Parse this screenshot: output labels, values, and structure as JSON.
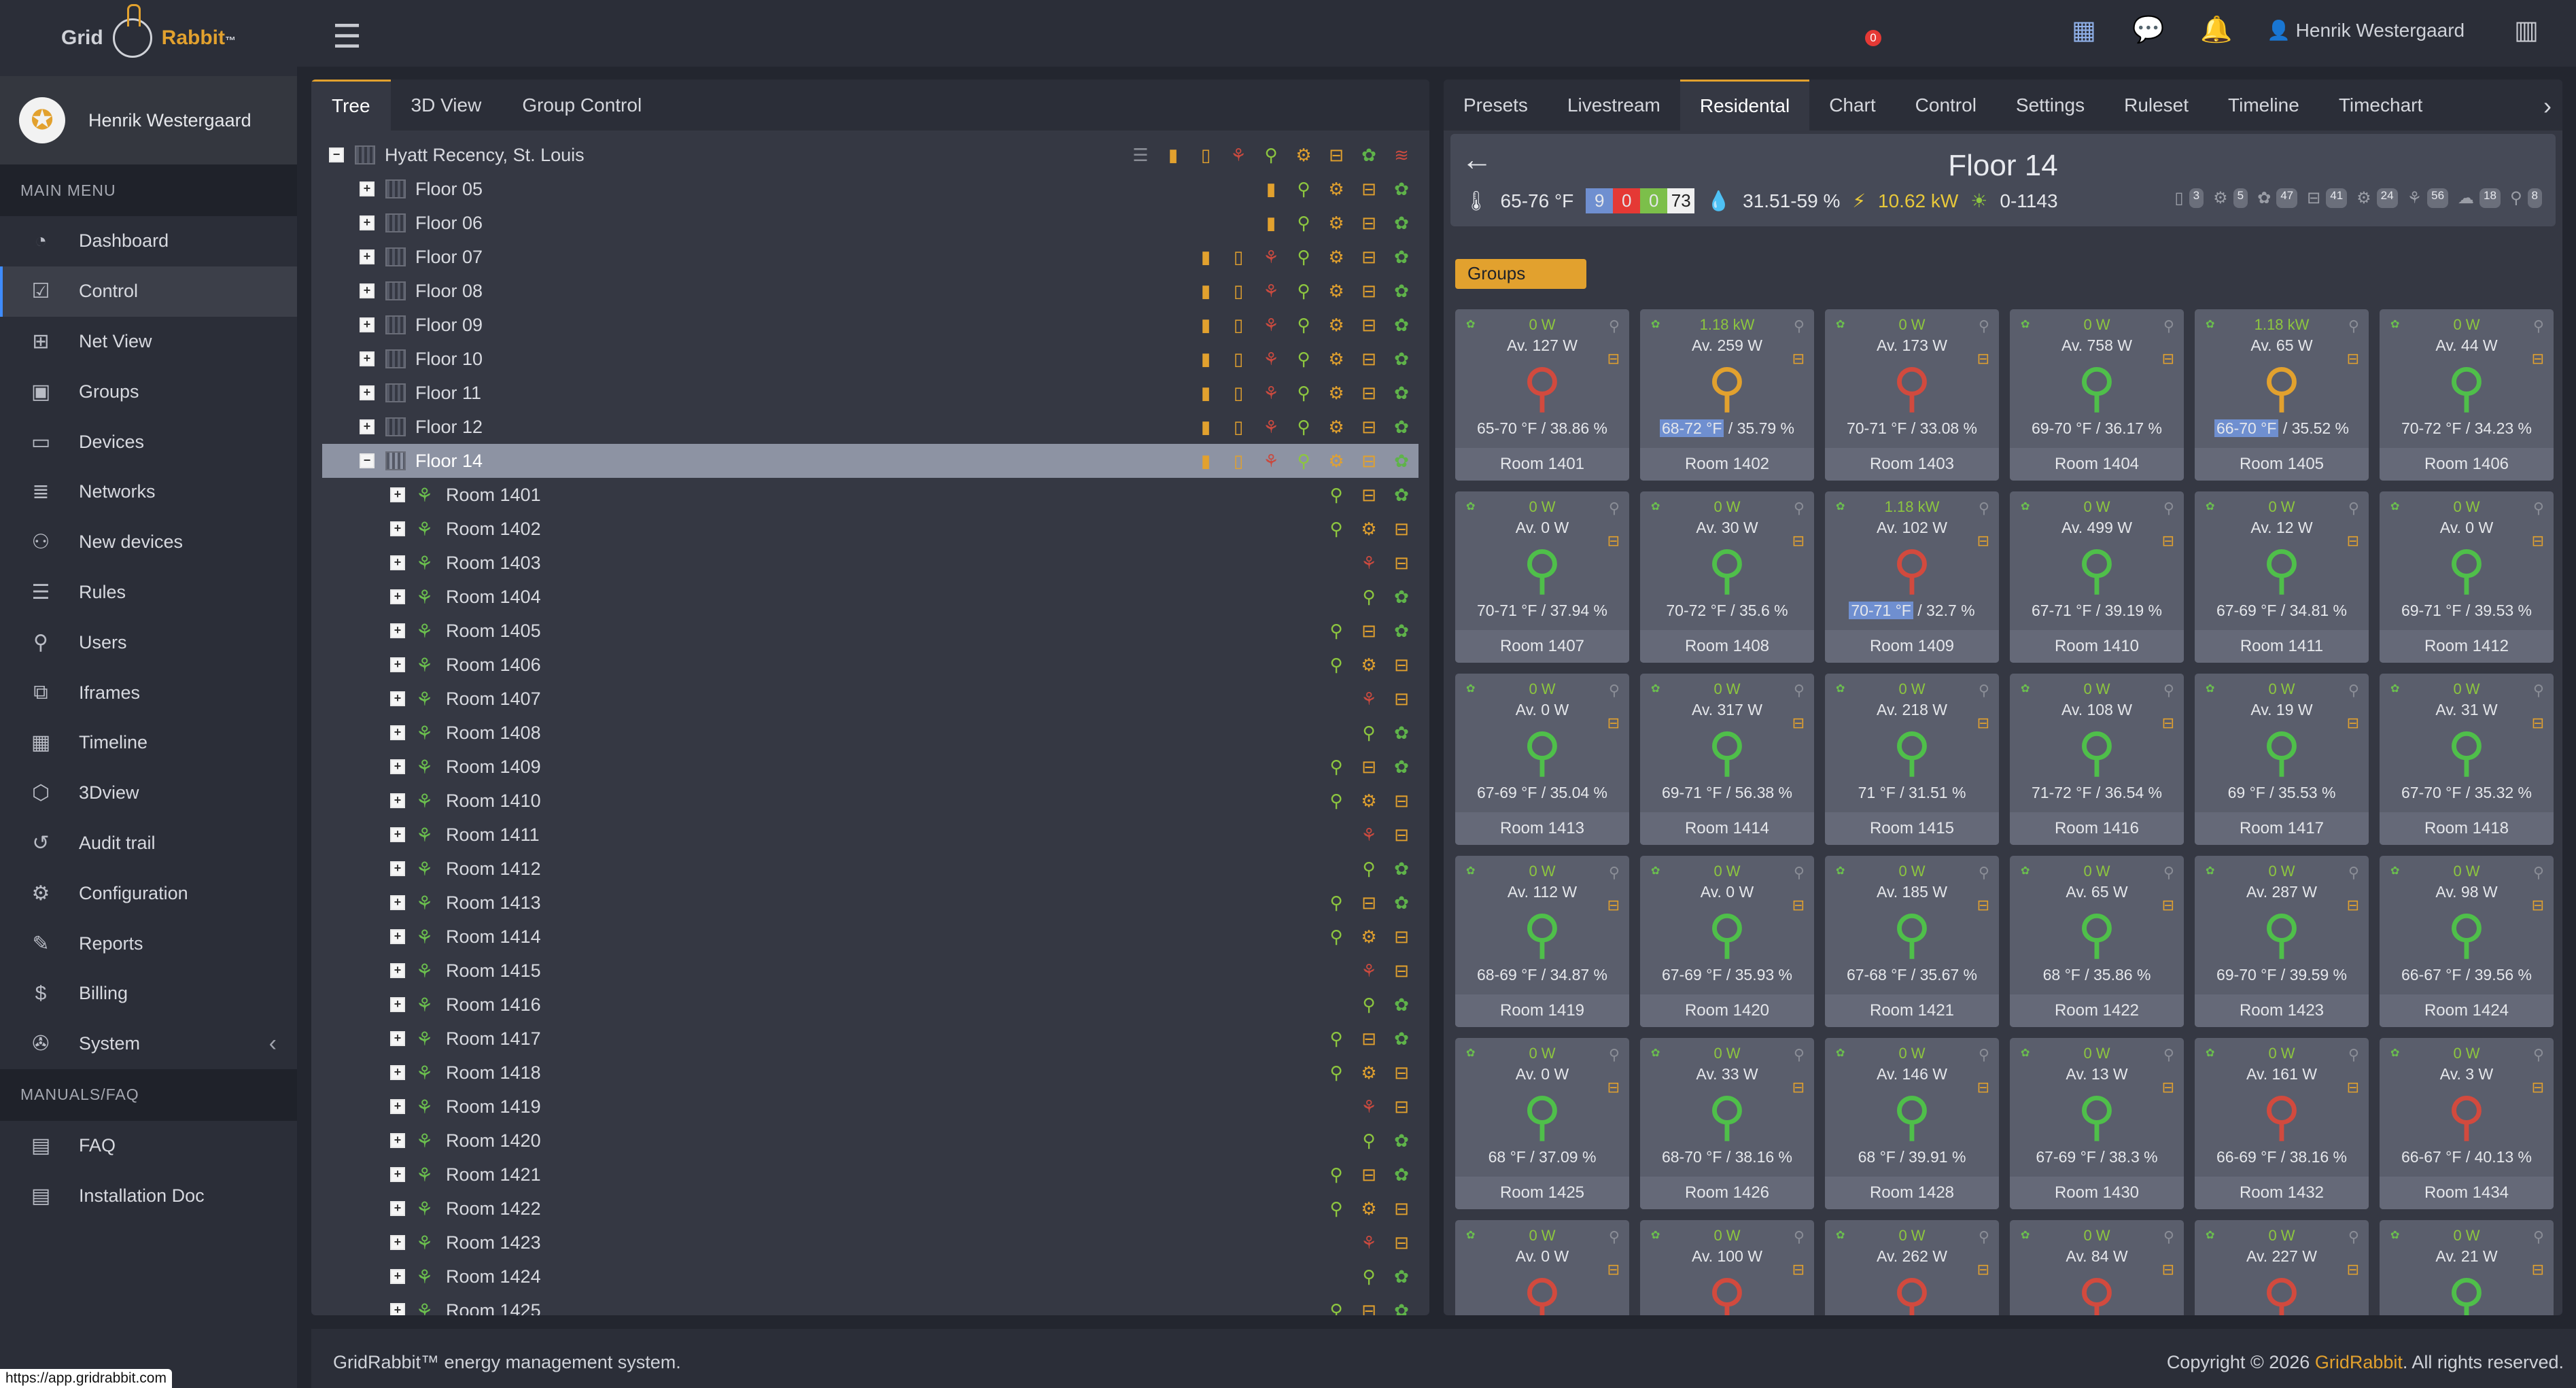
{
  "brand": {
    "logo_a": "Grid",
    "logo_b": "Rabbit",
    "logo_tm": "™"
  },
  "user": {
    "name": "Henrik Westergaard"
  },
  "sidebar": {
    "main_header": "MAIN MENU",
    "items": [
      {
        "label": "Dashboard",
        "icon": "dashboard-icon",
        "glyph": "◔"
      },
      {
        "label": "Control",
        "icon": "control-icon",
        "glyph": "☑"
      },
      {
        "label": "Net View",
        "icon": "net-view-icon",
        "glyph": "⊞"
      },
      {
        "label": "Groups",
        "icon": "groups-icon",
        "glyph": "▣"
      },
      {
        "label": "Devices",
        "icon": "devices-icon",
        "glyph": "▭"
      },
      {
        "label": "Networks",
        "icon": "networks-icon",
        "glyph": "≣"
      },
      {
        "label": "New devices",
        "icon": "new-devices-icon",
        "glyph": "⚇"
      },
      {
        "label": "Rules",
        "icon": "rules-icon",
        "glyph": "☰"
      },
      {
        "label": "Users",
        "icon": "users-icon",
        "glyph": "⚲"
      },
      {
        "label": "Iframes",
        "icon": "iframes-icon",
        "glyph": "⧉"
      },
      {
        "label": "Timeline",
        "icon": "timeline-icon",
        "glyph": "▦"
      },
      {
        "label": "3Dview",
        "icon": "3dview-icon",
        "glyph": "⬡"
      },
      {
        "label": "Audit trail",
        "icon": "audit-trail-icon",
        "glyph": "↺"
      },
      {
        "label": "Configuration",
        "icon": "configuration-icon",
        "glyph": "⚙"
      },
      {
        "label": "Reports",
        "icon": "reports-icon",
        "glyph": "✎"
      },
      {
        "label": "Billing",
        "icon": "billing-icon",
        "glyph": "$"
      },
      {
        "label": "System",
        "icon": "system-icon",
        "glyph": "✇"
      }
    ],
    "manuals_header": "MANUALS/FAQ",
    "manuals": [
      {
        "label": "FAQ",
        "icon": "faq-icon",
        "glyph": "▤"
      },
      {
        "label": "Installation Doc",
        "icon": "installation-doc-icon",
        "glyph": "▤"
      }
    ]
  },
  "statusbar_url": "https://app.gridrabbit.com",
  "topbar": {
    "notif_count": "0"
  },
  "left_tabs": [
    "Tree",
    "3D View",
    "Group Control"
  ],
  "tree": {
    "root": "Hyatt Recency, St. Louis",
    "floors": [
      "Floor 05",
      "Floor 06",
      "Floor 07",
      "Floor 08",
      "Floor 09",
      "Floor 10",
      "Floor 11",
      "Floor 12",
      "Floor 14"
    ],
    "rooms": [
      "Room 1401",
      "Room 1402",
      "Room 1403",
      "Room 1404",
      "Room 1405",
      "Room 1406",
      "Room 1407",
      "Room 1408",
      "Room 1409",
      "Room 1410",
      "Room 1411",
      "Room 1412",
      "Room 1413",
      "Room 1414",
      "Room 1415",
      "Room 1416",
      "Room 1417",
      "Room 1418",
      "Room 1419",
      "Room 1420",
      "Room 1421",
      "Room 1422",
      "Room 1423",
      "Room 1424",
      "Room 1425"
    ]
  },
  "right_tabs": [
    "Presets",
    "Livestream",
    "Residental",
    "Chart",
    "Control",
    "Settings",
    "Ruleset",
    "Timeline",
    "Timechart"
  ],
  "floor": {
    "title": "Floor 14",
    "temp": "65-76 °F",
    "counts": [
      "9",
      "0",
      "0",
      "73"
    ],
    "humidity": "31.51-59 %",
    "power": "10.62 kW",
    "light": "0-1143",
    "badges": [
      "3",
      "5",
      "47",
      "41",
      "24",
      "56",
      "18",
      "8"
    ]
  },
  "groups_label": "Groups",
  "rooms": [
    {
      "p": "0 W",
      "av": "Av. 127 W",
      "t": "65-70 °F",
      "h": "/ 38.86 %",
      "n": "Room 1401",
      "s": "red",
      "hl": false
    },
    {
      "p": "1.18 kW",
      "av": "Av. 259 W",
      "t": "68-72 °F",
      "h": "/ 35.79 %",
      "n": "Room 1402",
      "s": "orange",
      "hl": true
    },
    {
      "p": "0 W",
      "av": "Av. 173 W",
      "t": "70-71 °F",
      "h": "/ 33.08 %",
      "n": "Room 1403",
      "s": "red",
      "hl": false
    },
    {
      "p": "0 W",
      "av": "Av. 758 W",
      "t": "69-70 °F",
      "h": "/ 36.17 %",
      "n": "Room 1404",
      "s": "green",
      "hl": false
    },
    {
      "p": "1.18 kW",
      "av": "Av. 65 W",
      "t": "66-70 °F",
      "h": "/ 35.52 %",
      "n": "Room 1405",
      "s": "orange",
      "hl": true
    },
    {
      "p": "0 W",
      "av": "Av. 44 W",
      "t": "70-72 °F",
      "h": "/ 34.23 %",
      "n": "Room 1406",
      "s": "green",
      "hl": false
    },
    {
      "p": "0 W",
      "av": "Av. 0 W",
      "t": "70-71 °F",
      "h": "/ 37.94 %",
      "n": "Room 1407",
      "s": "green",
      "hl": false
    },
    {
      "p": "0 W",
      "av": "Av. 30 W",
      "t": "70-72 °F",
      "h": "/ 35.6 %",
      "n": "Room 1408",
      "s": "green",
      "hl": false
    },
    {
      "p": "1.18 kW",
      "av": "Av. 102 W",
      "t": "70-71 °F",
      "h": "/ 32.7 %",
      "n": "Room 1409",
      "s": "red",
      "hl": true
    },
    {
      "p": "0 W",
      "av": "Av. 499 W",
      "t": "67-71 °F",
      "h": "/ 39.19 %",
      "n": "Room 1410",
      "s": "green",
      "hl": false
    },
    {
      "p": "0 W",
      "av": "Av. 12 W",
      "t": "67-69 °F",
      "h": "/ 34.81 %",
      "n": "Room 1411",
      "s": "green",
      "hl": false
    },
    {
      "p": "0 W",
      "av": "Av. 0 W",
      "t": "69-71 °F",
      "h": "/ 39.53 %",
      "n": "Room 1412",
      "s": "green",
      "hl": false
    },
    {
      "p": "0 W",
      "av": "Av. 0 W",
      "t": "67-69 °F",
      "h": "/ 35.04 %",
      "n": "Room 1413",
      "s": "green",
      "hl": false
    },
    {
      "p": "0 W",
      "av": "Av. 317 W",
      "t": "69-71 °F",
      "h": "/ 56.38 %",
      "n": "Room 1414",
      "s": "green",
      "hl": false
    },
    {
      "p": "0 W",
      "av": "Av. 218 W",
      "t": "71 °F",
      "h": "/ 31.51 %",
      "n": "Room 1415",
      "s": "green",
      "hl": false
    },
    {
      "p": "0 W",
      "av": "Av. 108 W",
      "t": "71-72 °F",
      "h": "/ 36.54 %",
      "n": "Room 1416",
      "s": "green",
      "hl": false
    },
    {
      "p": "0 W",
      "av": "Av. 19 W",
      "t": "69 °F",
      "h": "/ 35.53 %",
      "n": "Room 1417",
      "s": "green",
      "hl": false
    },
    {
      "p": "0 W",
      "av": "Av. 31 W",
      "t": "67-70 °F",
      "h": "/ 35.32 %",
      "n": "Room 1418",
      "s": "green",
      "hl": false
    },
    {
      "p": "0 W",
      "av": "Av. 112 W",
      "t": "68-69 °F",
      "h": "/ 34.87 %",
      "n": "Room 1419",
      "s": "green",
      "hl": false
    },
    {
      "p": "0 W",
      "av": "Av. 0 W",
      "t": "67-69 °F",
      "h": "/ 35.93 %",
      "n": "Room 1420",
      "s": "green",
      "hl": false
    },
    {
      "p": "0 W",
      "av": "Av. 185 W",
      "t": "67-68 °F",
      "h": "/ 35.67 %",
      "n": "Room 1421",
      "s": "green",
      "hl": false
    },
    {
      "p": "0 W",
      "av": "Av. 65 W",
      "t": "68 °F",
      "h": "/ 35.86 %",
      "n": "Room 1422",
      "s": "green",
      "hl": false
    },
    {
      "p": "0 W",
      "av": "Av. 287 W",
      "t": "69-70 °F",
      "h": "/ 39.59 %",
      "n": "Room 1423",
      "s": "green",
      "hl": false
    },
    {
      "p": "0 W",
      "av": "Av. 98 W",
      "t": "66-67 °F",
      "h": "/ 39.56 %",
      "n": "Room 1424",
      "s": "green",
      "hl": false
    },
    {
      "p": "0 W",
      "av": "Av. 0 W",
      "t": "68 °F",
      "h": "/ 37.09 %",
      "n": "Room 1425",
      "s": "green",
      "hl": false
    },
    {
      "p": "0 W",
      "av": "Av. 33 W",
      "t": "68-70 °F",
      "h": "/ 38.16 %",
      "n": "Room 1426",
      "s": "green",
      "hl": false
    },
    {
      "p": "0 W",
      "av": "Av. 146 W",
      "t": "68 °F",
      "h": "/ 39.91 %",
      "n": "Room 1428",
      "s": "green",
      "hl": false
    },
    {
      "p": "0 W",
      "av": "Av. 13 W",
      "t": "67-69 °F",
      "h": "/ 38.3 %",
      "n": "Room 1430",
      "s": "green",
      "hl": false
    },
    {
      "p": "0 W",
      "av": "Av. 161 W",
      "t": "66-69 °F",
      "h": "/ 38.16 %",
      "n": "Room 1432",
      "s": "red",
      "hl": false
    },
    {
      "p": "0 W",
      "av": "Av. 3 W",
      "t": "66-67 °F",
      "h": "/ 40.13 %",
      "n": "Room 1434",
      "s": "red",
      "hl": false
    },
    {
      "p": "0 W",
      "av": "Av. 0 W",
      "t": "",
      "h": "",
      "n": "",
      "s": "red",
      "hl": false
    },
    {
      "p": "0 W",
      "av": "Av. 100 W",
      "t": "",
      "h": "",
      "n": "",
      "s": "red",
      "hl": false
    },
    {
      "p": "0 W",
      "av": "Av. 262 W",
      "t": "",
      "h": "",
      "n": "",
      "s": "red",
      "hl": false
    },
    {
      "p": "0 W",
      "av": "Av. 84 W",
      "t": "",
      "h": "",
      "n": "",
      "s": "red",
      "hl": false
    },
    {
      "p": "0 W",
      "av": "Av. 227 W",
      "t": "",
      "h": "",
      "n": "",
      "s": "red",
      "hl": false
    },
    {
      "p": "0 W",
      "av": "Av. 21 W",
      "t": "",
      "h": "",
      "n": "",
      "s": "green",
      "hl": false
    }
  ],
  "footer": {
    "left": "GridRabbit™ energy management system.",
    "copy": "Copyright © 2026 ",
    "brand": "GridRabbit",
    "rights": ". All rights reserved."
  }
}
